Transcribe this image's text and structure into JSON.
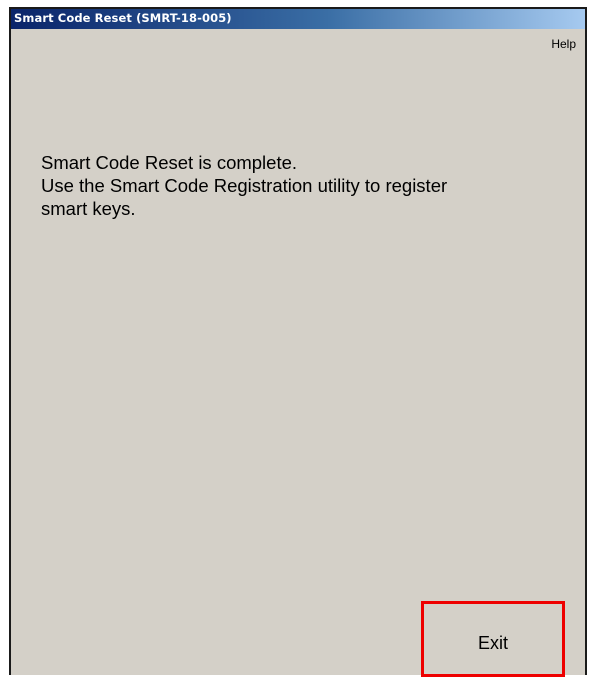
{
  "window": {
    "title": "Smart Code Reset (SMRT-18-005)"
  },
  "menu": {
    "help_label": "Help"
  },
  "message": {
    "lines": [
      "Smart Code Reset is complete.",
      "Use the Smart Code Registration utility to register",
      "smart keys."
    ]
  },
  "buttons": {
    "exit_label": "Exit"
  },
  "colors": {
    "window_background": "#d4d0c8",
    "titlebar_start": "#0a246a",
    "titlebar_end": "#a6caf0",
    "highlight": "#ee0000"
  }
}
